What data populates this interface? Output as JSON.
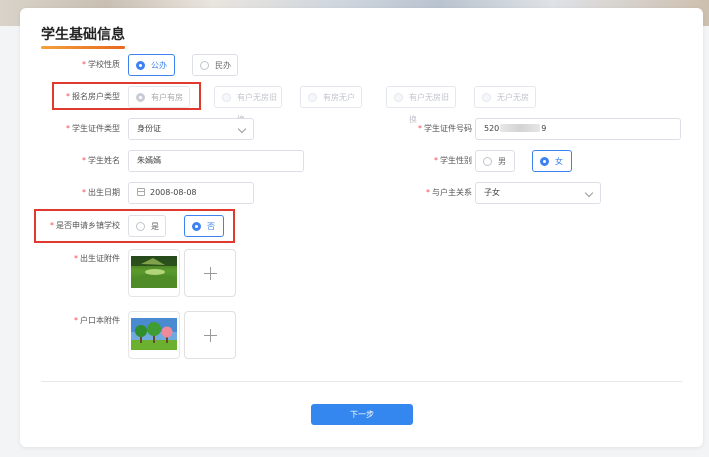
{
  "page": {
    "title": "学生基础信息",
    "next_button": "下一步"
  },
  "colors": {
    "accent": "#3d82f0",
    "title_underline": "#e9671f",
    "highlight_box": "#e03a2f",
    "required_star": "#f04a4a"
  },
  "form": {
    "school_nature": {
      "label": "学校性质",
      "options": [
        "公办",
        "民办"
      ],
      "selected": "公办"
    },
    "household_type": {
      "label": "报名房户类型",
      "options": [
        "有户有房",
        "有户无房旧换",
        "有房无户",
        "有户无房旧换",
        "无户无房"
      ],
      "selected": "有户有房"
    },
    "id_type": {
      "label": "学生证件类型",
      "value": "身份证",
      "icon": "chevron-down-icon"
    },
    "id_number": {
      "label": "学生证件号码",
      "value_prefix": "520",
      "value_suffix": "9"
    },
    "student_name": {
      "label": "学生姓名",
      "value": "朱嫣嫣"
    },
    "gender": {
      "label": "学生性别",
      "options": [
        "男",
        "女"
      ],
      "selected": "女"
    },
    "birth_date": {
      "label": "出生日期",
      "value": "2008-08-08",
      "icon": "calendar-icon"
    },
    "relation": {
      "label": "与户主关系",
      "value": "子女",
      "icon": "chevron-down-icon"
    },
    "township_school": {
      "label": "是否申请乡镇学校",
      "options": [
        "是",
        "否"
      ],
      "selected": "否"
    },
    "birth_certificate": {
      "label": "出生证附件",
      "upload_icon": "plus-icon"
    },
    "household_register": {
      "label": "户口本附件",
      "upload_icon": "plus-icon"
    }
  },
  "required_mark": "*"
}
